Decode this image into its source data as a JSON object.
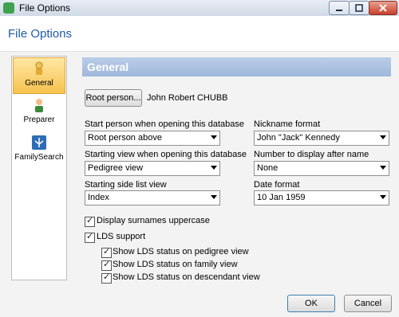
{
  "window": {
    "title": "File Options"
  },
  "dialog": {
    "title": "File Options"
  },
  "nav": {
    "items": [
      {
        "label": "General",
        "selected": true
      },
      {
        "label": "Preparer",
        "selected": false
      },
      {
        "label": "FamilySearch",
        "selected": false
      }
    ]
  },
  "panel": {
    "title": "General",
    "root_person_button": "Root person...",
    "root_person_name": "John Robert CHUBB",
    "start_person_label": "Start person when opening this database",
    "start_person_value": "Root person above",
    "starting_view_label": "Starting view when opening this database",
    "starting_view_value": "Pedigree view",
    "side_list_label": "Starting side list view",
    "side_list_value": "Index",
    "nickname_label": "Nickname format",
    "nickname_value": "John \"Jack\" Kennedy",
    "number_label": "Number to display after name",
    "number_value": "None",
    "date_label": "Date format",
    "date_value": "10 Jan 1959",
    "checkboxes": [
      {
        "label": "Display surnames uppercase",
        "checked": true
      },
      {
        "label": "LDS support",
        "checked": true
      },
      {
        "label": "Show LDS status on pedigree view",
        "checked": true
      },
      {
        "label": "Show LDS status on family view",
        "checked": true
      },
      {
        "label": "Show LDS status on descendant view",
        "checked": true
      }
    ]
  },
  "footer": {
    "ok_label": "OK",
    "cancel_label": "Cancel"
  },
  "colors": {
    "accent": "#1f5aa6",
    "panel_header": "#a9c1e2",
    "nav_selected": "#f6c24f"
  }
}
